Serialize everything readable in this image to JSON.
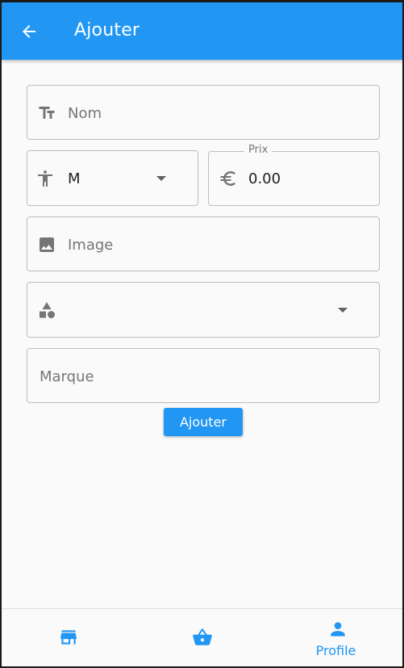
{
  "appbar": {
    "title": "Ajouter",
    "back_icon": "arrow-back-icon",
    "color": "#2196f3"
  },
  "form": {
    "nom": {
      "placeholder": "Nom",
      "icon": "text-fields-icon"
    },
    "taille": {
      "value": "M",
      "icon": "accessibility-icon"
    },
    "prix": {
      "label": "Prix",
      "value": "0.00",
      "icon": "euro-icon"
    },
    "image": {
      "placeholder": "Image",
      "icon": "image-icon"
    },
    "categorie": {
      "value": "",
      "icon": "category-icon"
    },
    "marque": {
      "placeholder": "Marque"
    },
    "submit_label": "Ajouter"
  },
  "bottom_nav": {
    "items": [
      {
        "icon": "store-icon",
        "label": ""
      },
      {
        "icon": "shopping-basket-icon",
        "label": ""
      },
      {
        "icon": "person-icon",
        "label": "Profile",
        "active": true
      }
    ],
    "active_color": "#2196f3"
  }
}
